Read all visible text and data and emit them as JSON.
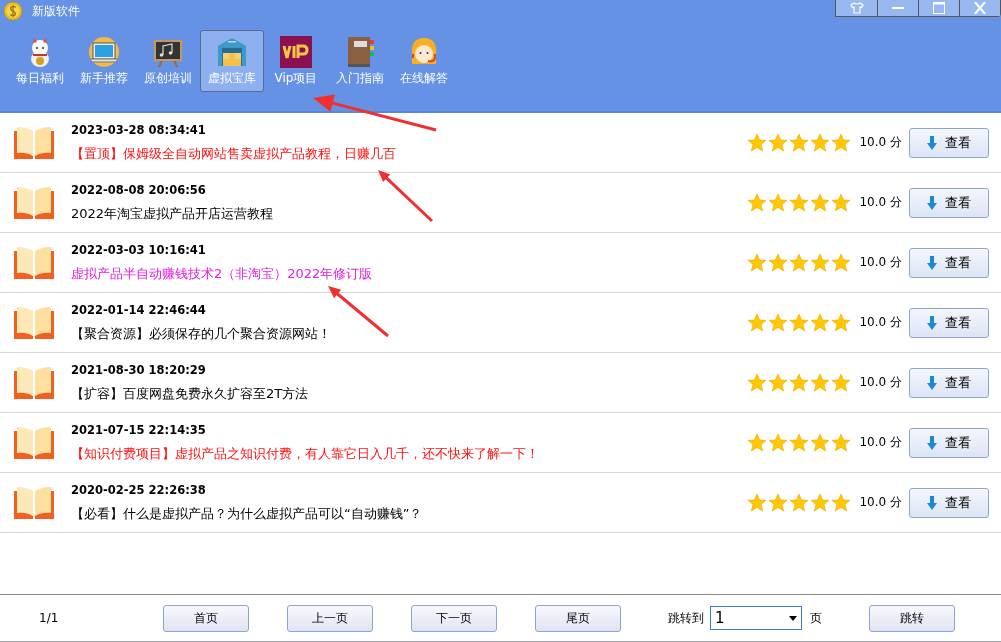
{
  "window": {
    "title": "新版软件"
  },
  "tabs": [
    {
      "label": "每日福利",
      "selected": false
    },
    {
      "label": "新手推荐",
      "selected": false
    },
    {
      "label": "原创培训",
      "selected": false
    },
    {
      "label": "虚拟宝库",
      "selected": true
    },
    {
      "label": "Vip项目",
      "selected": false
    },
    {
      "label": "入门指南",
      "selected": false
    },
    {
      "label": "在线解答",
      "selected": false
    }
  ],
  "items": [
    {
      "time": "2023-03-28 08:34:41",
      "title": "【置顶】保姆级全自动网站售卖虚拟产品教程，日赚几百",
      "color": "#ff1010",
      "stars": 5,
      "score": "10.0 分",
      "button": "查看"
    },
    {
      "time": "2022-08-08 20:06:56",
      "title": "2022年淘宝虚拟产品开店运营教程",
      "color": "#000000",
      "stars": 5,
      "score": "10.0 分",
      "button": "查看"
    },
    {
      "time": "2022-03-03 10:16:41",
      "title": "虚拟产品半自动赚钱技术2（非淘宝）2022年修订版",
      "color": "#e020e0",
      "stars": 5,
      "score": "10.0 分",
      "button": "查看"
    },
    {
      "time": "2022-01-14 22:46:44",
      "title": "【聚合资源】必须保存的几个聚合资源网站！",
      "color": "#000000",
      "stars": 5,
      "score": "10.0 分",
      "button": "查看"
    },
    {
      "time": "2021-08-30 18:20:29",
      "title": "【扩容】百度网盘免费永久扩容至2T方法",
      "color": "#000000",
      "stars": 5,
      "score": "10.0 分",
      "button": "查看"
    },
    {
      "time": "2021-07-15 22:14:35",
      "title": "【知识付费项目】虚拟产品之知识付费，有人靠它日入几千，还不快来了解一下！",
      "color": "#ff1010",
      "stars": 5,
      "score": "10.0 分",
      "button": "查看"
    },
    {
      "time": "2020-02-25 22:26:38",
      "title": "【必看】什么是虚拟产品？为什么虚拟产品可以“自动赚钱”？",
      "color": "#000000",
      "stars": 5,
      "score": "10.0 分",
      "button": "查看"
    }
  ],
  "pager": {
    "page_info": "1/1",
    "buttons": [
      "首页",
      "上一页",
      "下一页",
      "尾页"
    ],
    "jump_label": "跳转到",
    "jump_value": "1",
    "page_unit": "页",
    "jump_button": "跳转"
  }
}
